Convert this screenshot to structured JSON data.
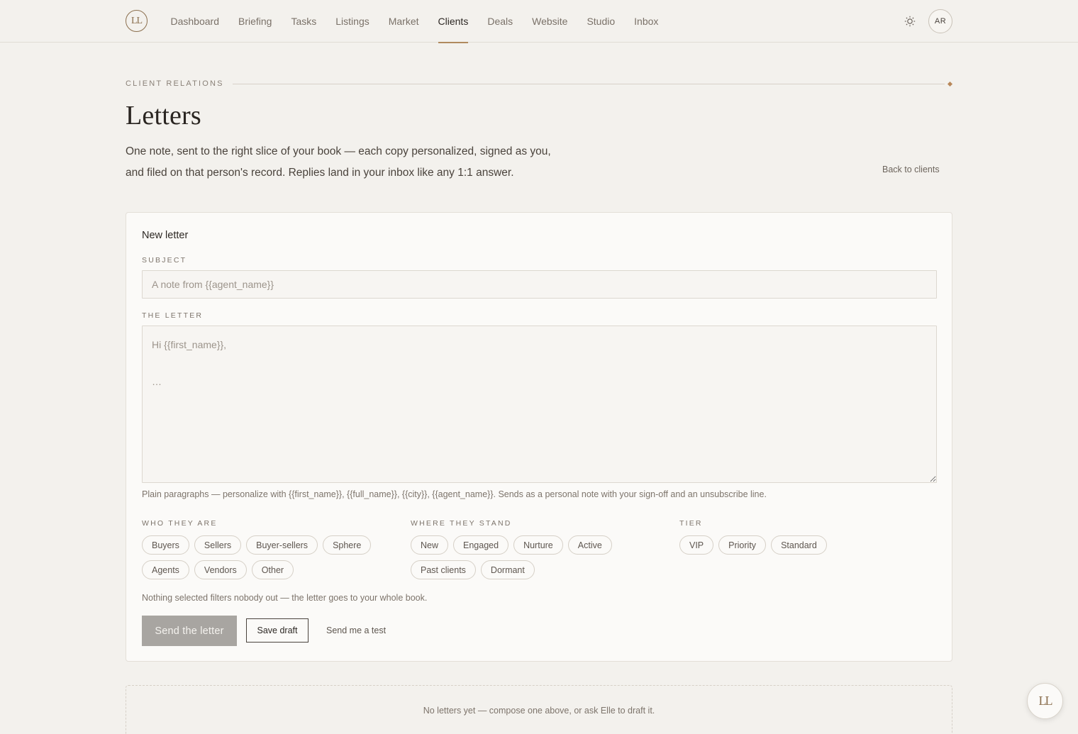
{
  "brand": {
    "logo_text": "LL",
    "logo_icon": "monogram-logo"
  },
  "nav": {
    "items": [
      {
        "label": "Dashboard",
        "active": false
      },
      {
        "label": "Briefing",
        "active": false
      },
      {
        "label": "Tasks",
        "active": false
      },
      {
        "label": "Listings",
        "active": false
      },
      {
        "label": "Market",
        "active": false
      },
      {
        "label": "Clients",
        "active": true
      },
      {
        "label": "Deals",
        "active": false
      },
      {
        "label": "Website",
        "active": false
      },
      {
        "label": "Studio",
        "active": false
      },
      {
        "label": "Inbox",
        "active": false
      }
    ],
    "theme_icon": "sun-icon",
    "avatar_initials": "AR"
  },
  "header": {
    "eyebrow": "CLIENT RELATIONS",
    "title": "Letters",
    "intro": "One note, sent to the right slice of your book — each copy personalized, signed as you, and filed on that person's record. Replies land in your inbox like any 1:1 answer.",
    "back_link": "Back to clients"
  },
  "composer": {
    "title": "New letter",
    "subject_label": "SUBJECT",
    "subject_placeholder": "A note from {{agent_name}}",
    "subject_value": "",
    "letter_label": "THE LETTER",
    "letter_placeholder": "Hi {{first_name}},\n\n…",
    "letter_value": "",
    "hint": "Plain paragraphs — personalize with {{first_name}}, {{full_name}}, {{city}}, {{agent_name}}. Sends as a personal note with your sign-off and an unsubscribe line.",
    "filters": [
      {
        "label": "WHO THEY ARE",
        "chips": [
          "Buyers",
          "Sellers",
          "Buyer-sellers",
          "Sphere",
          "Agents",
          "Vendors",
          "Other"
        ]
      },
      {
        "label": "WHERE THEY STAND",
        "chips": [
          "New",
          "Engaged",
          "Nurture",
          "Active",
          "Past clients",
          "Dormant"
        ]
      },
      {
        "label": "TIER",
        "chips": [
          "VIP",
          "Priority",
          "Standard"
        ]
      }
    ],
    "filter_note": "Nothing selected filters nobody out — the letter goes to your whole book.",
    "send_label": "Send the letter",
    "draft_label": "Save draft",
    "test_label": "Send me a test"
  },
  "empty_state": "No letters yet — compose one above, or ask Elle to draft it.",
  "assistant": {
    "fab_text": "LL",
    "icon": "assistant-monogram-icon"
  },
  "colors": {
    "accent": "#b08a5e",
    "background": "#f3f1ed",
    "card": "#fbfaf8",
    "disabled_button": "#a8a5a1"
  }
}
